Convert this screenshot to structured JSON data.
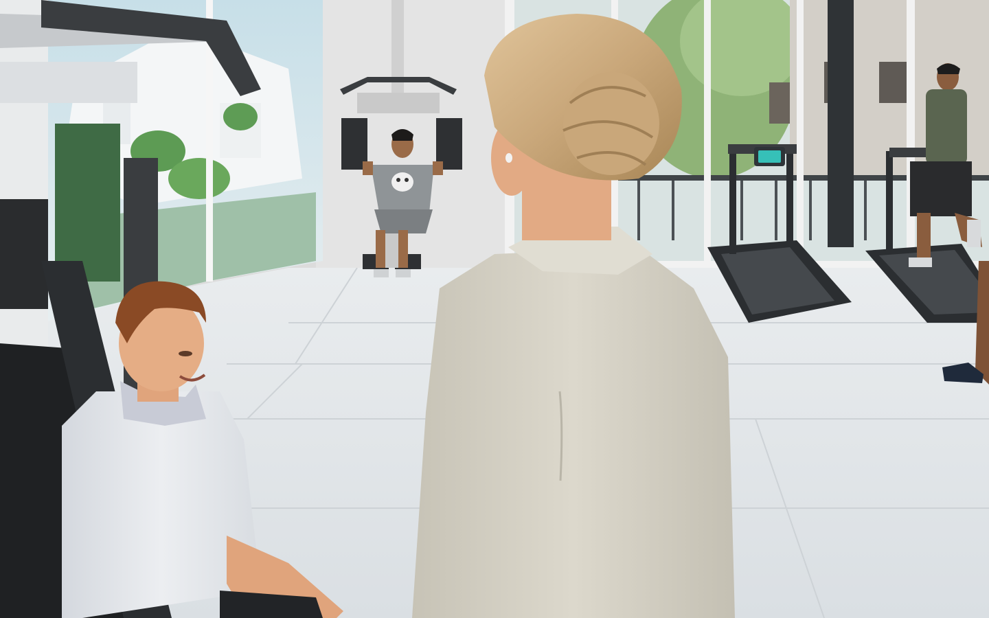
{
  "scene": {
    "setting": "gym",
    "colors": {
      "floor": "#e3e7ea",
      "wall": "#dcdcdc",
      "window_tint": "#c9d5d8",
      "treadmill_screen": "#36c0b8",
      "hair_blonde": "#c9a77a",
      "hair_auburn": "#8a4a25",
      "jacket": "#d6d2c6",
      "sweater": "#e6e8ec"
    }
  }
}
